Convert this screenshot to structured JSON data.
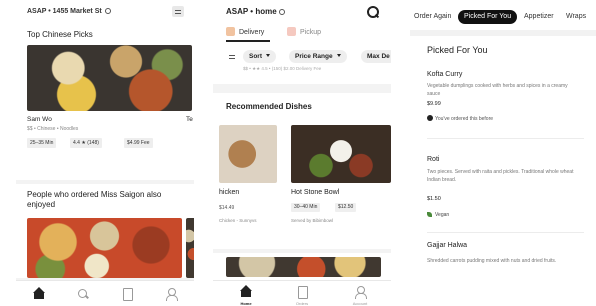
{
  "screen1": {
    "address": "ASAP • 1455 Market St",
    "section_title": "Top Chinese Picks",
    "restaurant": {
      "name": "Sam Wo",
      "sub": "$$ • Chinese • Noodles",
      "time": "25–35 Min",
      "rating": "4.4",
      "reviews": "(148)",
      "fee": "$4.99 Fee"
    },
    "next_restaurant_initial": "Te",
    "section2_title": "People who ordered Miss Saigon also enjoyed",
    "tabs": [
      "Home",
      "Search",
      "Orders",
      "Account"
    ]
  },
  "screen2": {
    "address": "ASAP • home",
    "modes": {
      "delivery": "Delivery",
      "pickup": "Pickup"
    },
    "filters": {
      "sort": "Sort",
      "price": "Price Range",
      "max": "Max De"
    },
    "ghost_row": "$$ • ★★ 4.5 • (150)     $2.00 Delivery Fee",
    "section_title": "Recommended Dishes",
    "dish1": {
      "name": "hicken",
      "price": "$14.49",
      "source": "Chicken - Sunnyvs"
    },
    "dish2": {
      "name": "Hot Stone Bowl",
      "time": "30–40 Min",
      "price": "$12.50",
      "source": "Served by Bibimbowl"
    },
    "tabs": [
      "Home",
      "Orders",
      "Account"
    ]
  },
  "screen3": {
    "tabs": [
      "Order Again",
      "Picked For You",
      "Appetizer",
      "Wraps"
    ],
    "active_tab": "Picked For You",
    "section_title": "Picked For You",
    "items": [
      {
        "name": "Kofta Curry",
        "desc": "Vegetable dumplings cooked with herbs and spices in a creamy sauce",
        "price": "$9.99",
        "note": "You've ordered this before"
      },
      {
        "name": "Roti",
        "desc": "Two pieces. Served with raita and pickles. Traditional whole wheat Indian bread.",
        "price": "$1.50",
        "note": "Vegan"
      },
      {
        "name": "Gajjar Halwa",
        "desc": "Shredded carrots pudding mixed with nuts and dried fruits."
      }
    ]
  }
}
